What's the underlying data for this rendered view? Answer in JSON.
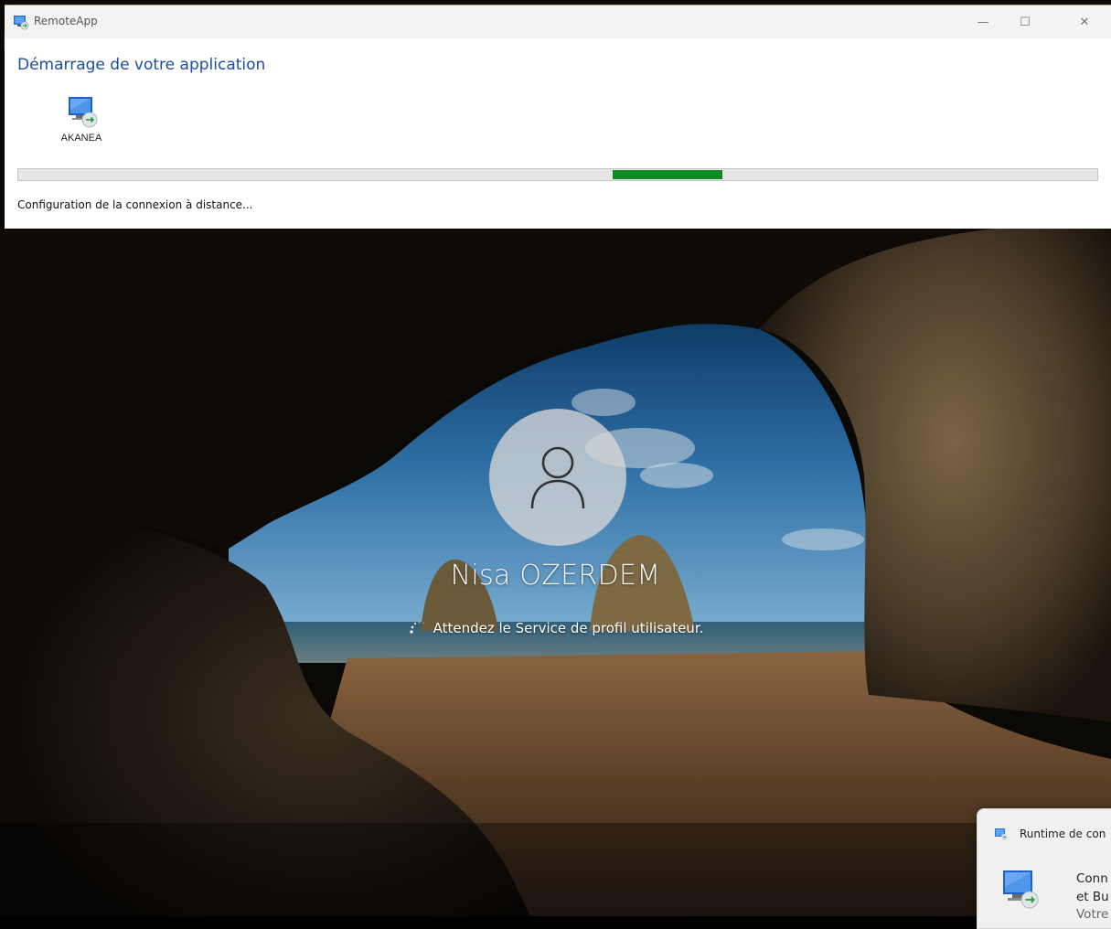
{
  "window": {
    "title": "RemoteApp",
    "controls": {
      "minimize": "—",
      "maximize": "☐",
      "close": "✕"
    }
  },
  "dialog": {
    "heading": "Démarrage de votre application",
    "app": {
      "label": "AKANEA",
      "icon": "remote-desktop-icon"
    },
    "progress": {
      "style": "marquee",
      "chunk_color": "#108a24"
    },
    "status": "Configuration de la connexion à distance..."
  },
  "lockscreen": {
    "user_name": "Nisa OZERDEM",
    "status": "Attendez le Service de profil utilisateur.",
    "avatar_icon": "user-icon",
    "spinner_icon": "loading-spinner-icon"
  },
  "toast": {
    "app_name": "Runtime de con",
    "line1": "Conn",
    "line2": "et Bu",
    "line3": "Votre",
    "icon": "remote-desktop-icon"
  },
  "colors": {
    "heading": "#1a4ea0",
    "progress": "#108a24",
    "titlebar": "#f3f3f3"
  }
}
